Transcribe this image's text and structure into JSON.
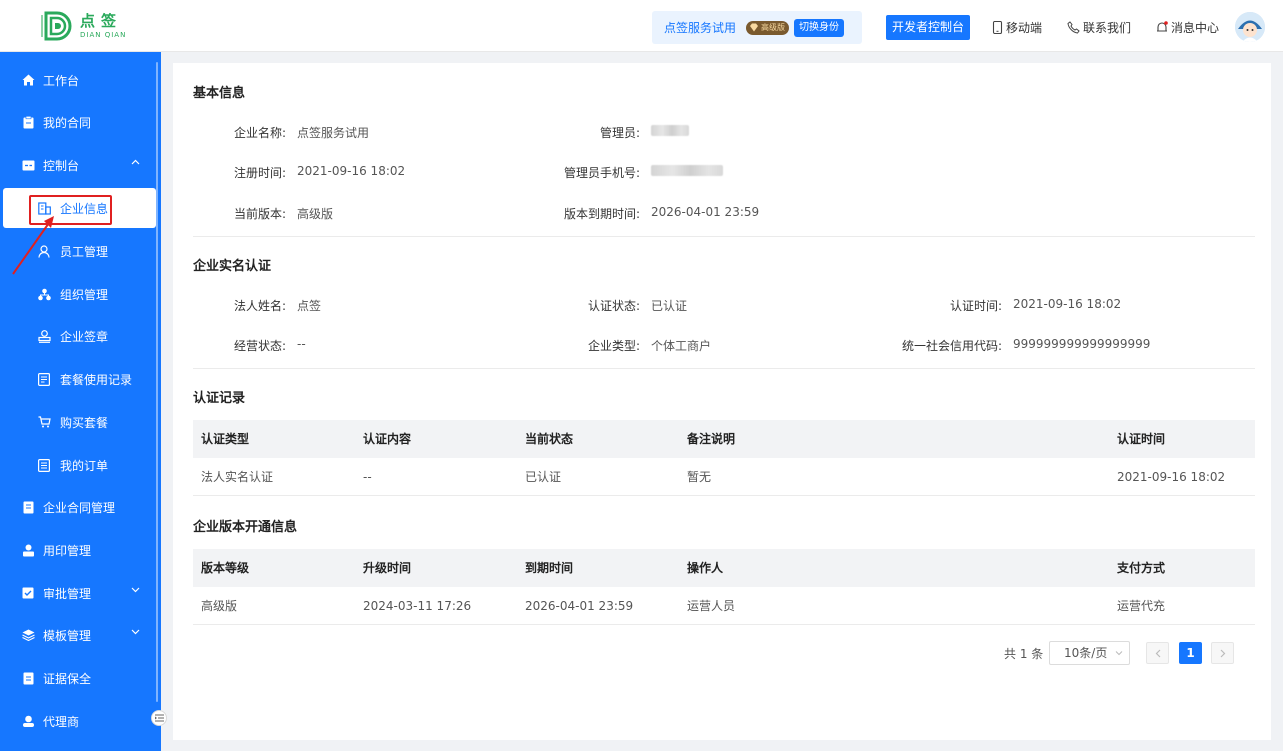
{
  "logo": {
    "cn": "点签",
    "en": "DIAN QIAN"
  },
  "header": {
    "trial_name": "点签服务试用",
    "vip_badge": "高级版",
    "switch_label": "切换身份",
    "dev_console": "开发者控制台",
    "mobile": "移动端",
    "contact": "联系我们",
    "messages": "消息中心"
  },
  "sidebar": {
    "items": [
      {
        "label": "工作台",
        "icon": "home-icon"
      },
      {
        "label": "我的合同",
        "icon": "clipboard-icon"
      },
      {
        "label": "控制台",
        "icon": "console-icon"
      },
      {
        "label": "企业信息",
        "icon": "building-icon"
      },
      {
        "label": "员工管理",
        "icon": "user-icon"
      },
      {
        "label": "组织管理",
        "icon": "org-icon"
      },
      {
        "label": "企业签章",
        "icon": "stamp-icon"
      },
      {
        "label": "套餐使用记录",
        "icon": "record-icon"
      },
      {
        "label": "购买套餐",
        "icon": "cart-icon"
      },
      {
        "label": "我的订单",
        "icon": "order-icon"
      },
      {
        "label": "企业合同管理",
        "icon": "contract-icon"
      },
      {
        "label": "用印管理",
        "icon": "seal-user-icon"
      },
      {
        "label": "审批管理",
        "icon": "approve-icon"
      },
      {
        "label": "模板管理",
        "icon": "layers-icon"
      },
      {
        "label": "证据保全",
        "icon": "evidence-icon"
      },
      {
        "label": "代理商",
        "icon": "agent-icon"
      }
    ]
  },
  "basic": {
    "title": "基本信息",
    "company_name_k": "企业名称:",
    "company_name_v": "点签服务试用",
    "admin_k": "管理员:",
    "reg_time_k": "注册时间:",
    "reg_time_v": "2021-09-16 18:02",
    "admin_phone_k": "管理员手机号:",
    "version_k": "当前版本:",
    "version_v": "高级版",
    "expire_k": "版本到期时间:",
    "expire_v": "2026-04-01 23:59"
  },
  "auth": {
    "title": "企业实名认证",
    "legal_k": "法人姓名:",
    "legal_v": "点签",
    "status_k": "认证状态:",
    "status_v": "已认证",
    "time_k": "认证时间:",
    "time_v": "2021-09-16 18:02",
    "biz_k": "经营状态:",
    "biz_v": "--",
    "type_k": "企业类型:",
    "type_v": "个体工商户",
    "credit_k": "统一社会信用代码:",
    "credit_v": "999999999999999999"
  },
  "records": {
    "title": "认证记录",
    "headers": [
      "认证类型",
      "认证内容",
      "当前状态",
      "备注说明",
      "认证时间"
    ],
    "rows": [
      [
        "法人实名认证",
        "--",
        "已认证",
        "暂无",
        "2021-09-16 18:02"
      ]
    ]
  },
  "versions": {
    "title": "企业版本开通信息",
    "headers": [
      "版本等级",
      "升级时间",
      "到期时间",
      "操作人",
      "支付方式"
    ],
    "rows": [
      [
        "高级版",
        "2024-03-11 17:26",
        "2026-04-01 23:59",
        "运营人员",
        "运营代充"
      ]
    ]
  },
  "pagination": {
    "total": "共 1 条",
    "page_size": "10条/页",
    "current": "1"
  },
  "colors": {
    "primary": "#1677ff",
    "highlight": "#e02020",
    "logo_green": "#2aa95b"
  }
}
